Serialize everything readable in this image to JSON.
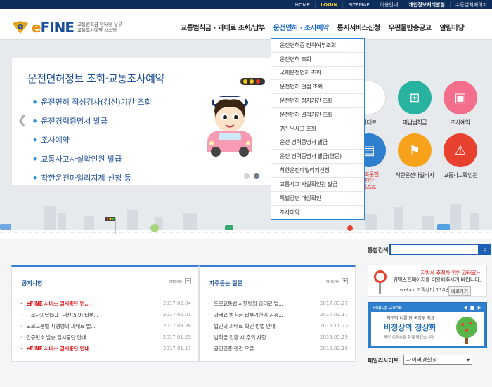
{
  "topbar": {
    "links": [
      "HOME",
      "LOGIN",
      "SITEMAP",
      "이용안내",
      "개인정보처리방침",
      "수동설치페이지"
    ]
  },
  "logo": {
    "name_e": "e",
    "name_rest": "FINE",
    "sub_line1": "교통범칙금 인터넷 납부",
    "sub_line2": "교통조사예약 시스템"
  },
  "gnb": {
    "items": [
      "교통범칙금 · 과태료 조회/납부",
      "운전면허 · 조사예약",
      "통지서비스신청",
      "우편물반송공고",
      "알림마당"
    ]
  },
  "dropdown": {
    "items": [
      "운전면허증 진위여부조회",
      "운전면허 조회",
      "국제운전면허 조회",
      "운전면허 벌점 조회",
      "운전면허 정지기간 조회",
      "운전면허 결격기간 조회",
      "7년 무사고 조회",
      "운전 경력증명서 발급",
      "운전 경력증명서 발급(영문)",
      "착한운전마일리지신청",
      "교통사고 사실확인원 발급",
      "특별감면 대상확인",
      "조사예약"
    ]
  },
  "banner": {
    "title": "운전면허정보 조회·교통조사예약",
    "items": [
      "운전면허 적성검사(갱신)기간 조회",
      "운전경력증명서 발급",
      "조사예약",
      "교통사고사실확인원 발급",
      "착한운전마일리지제 신청 등"
    ]
  },
  "quick": {
    "row1": [
      "과태료",
      "미납범칙금",
      "조사예약"
    ],
    "row2": [
      "불복운전\n진단\n리스트",
      "착한운전마일리지",
      "교통사고확인원"
    ],
    "colors": {
      "pink": "#f36e8a",
      "teal": "#27b3a0",
      "orange": "#f6a21a",
      "red": "#e9412f"
    }
  },
  "notice": {
    "title": "공지사항",
    "more": "more",
    "rows": [
      {
        "text": "eFINE 서비스 일시중단 안...",
        "date": "2017.05.04",
        "red": true
      },
      {
        "text": "근로자의날(5.1) 대선(5.9) 납부...",
        "date": "2017.05.01",
        "red": false
      },
      {
        "text": "도로교통법 시행령의 과태료 벌...",
        "date": "2017.03.28",
        "red": false
      },
      {
        "text": "인증번호 발송 일시중단 안내",
        "date": "2017.01.23",
        "red": false
      },
      {
        "text": "eFINE 서비스 일시중단 안내",
        "date": "2017.01.17",
        "red": true
      }
    ]
  },
  "faq": {
    "title": "자주묻는 질문",
    "more": "more",
    "rows": [
      {
        "text": "도로교통법 시행령의 과태료 벌...",
        "date": "2017.03.27"
      },
      {
        "text": "과태료 범칙금 납부기한이 공휴...",
        "date": "2017.03.17"
      },
      {
        "text": "법인의 과태료 확인 방법 안내",
        "date": "2015.11.23"
      },
      {
        "text": "범칙금 전환 시 주의 사항",
        "date": "2015.05.29"
      },
      {
        "text": "공인인증 관련 오류",
        "date": "2015.02.16"
      }
    ]
  },
  "search": {
    "label": "통합검색",
    "value": ""
  },
  "ad": {
    "line1": "지방세 주정차 위반 과태료는",
    "line2": "위택스홈페이지를 이용해주시기 바랍니다.",
    "line3": "wetax 고객센터 110번",
    "button": "바로가기"
  },
  "popup": {
    "title": "Popup Zone",
    "controls": "◀ ■ ▶",
    "sub": "차분히 너를 원 국정투 해요",
    "headline": "비정상의 정상화",
    "foot": "국민 여러분과 함께 하겠습니다"
  },
  "family": {
    "label": "패밀리사이트",
    "selected": "사이버경찰청"
  }
}
